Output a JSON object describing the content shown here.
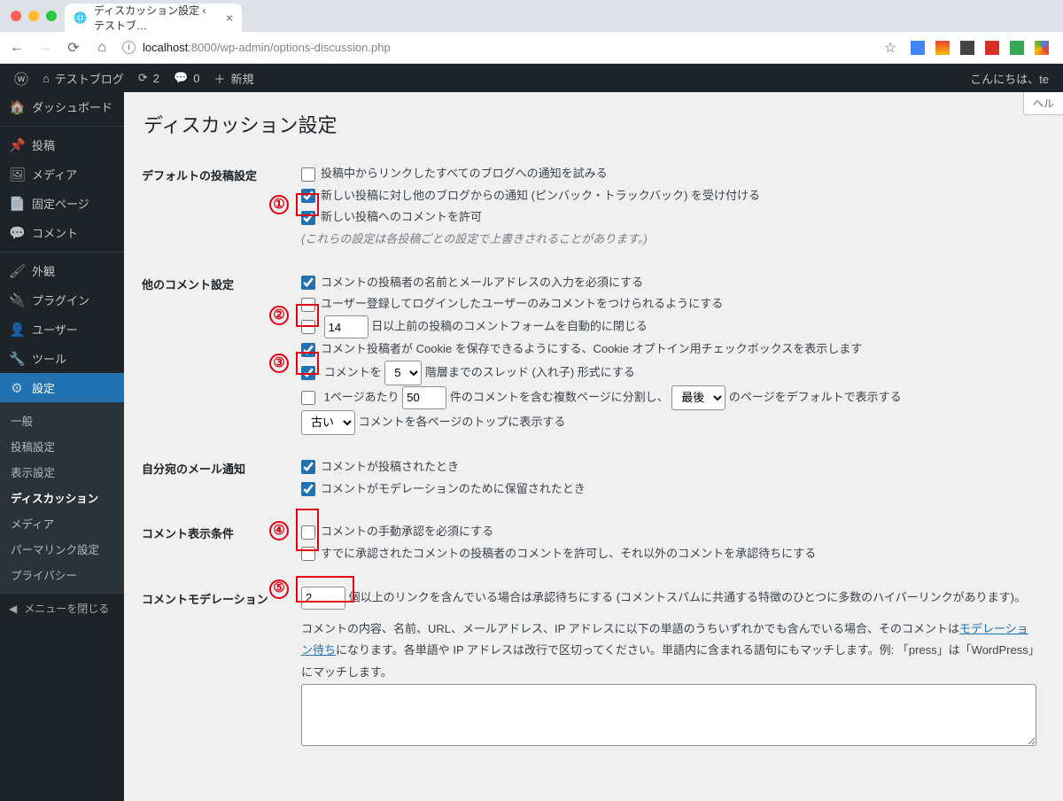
{
  "browser": {
    "tab_title": "ディスカッション設定 ‹ テストブ…",
    "url_host": "localhost",
    "url_port": ":8000",
    "url_path": "/wp-admin/options-discussion.php"
  },
  "adminbar": {
    "site_name": "テストブログ",
    "updates": "2",
    "comments": "0",
    "new": "新規",
    "greeting": "こんにちは、te"
  },
  "sidebar": {
    "dashboard": "ダッシュボード",
    "posts": "投稿",
    "media": "メディア",
    "pages": "固定ページ",
    "comments": "コメント",
    "appearance": "外観",
    "plugins": "プラグイン",
    "users": "ユーザー",
    "tools": "ツール",
    "settings": "設定",
    "submenu": {
      "general": "一般",
      "writing": "投稿設定",
      "reading": "表示設定",
      "discussion": "ディスカッション",
      "media": "メディア",
      "permalink": "パーマリンク設定",
      "privacy": "プライバシー"
    },
    "collapse": "メニューを閉じる"
  },
  "page": {
    "help_tab": "ヘル",
    "title": "ディスカッション設定",
    "sections": {
      "default_post": {
        "heading": "デフォルトの投稿設定",
        "opt_pingback": "投稿中からリンクしたすべてのブログへの通知を試みる",
        "opt_trackback": "新しい投稿に対し他のブログからの通知 (ピンバック・トラックバック) を受け付ける",
        "opt_allow_comments": "新しい投稿へのコメントを許可",
        "note": "(これらの設定は各投稿ごとの設定で上書きされることがあります。)"
      },
      "other_comment": {
        "heading": "他のコメント設定",
        "opt_require_name": "コメントの投稿者の名前とメールアドレスの入力を必須にする",
        "opt_require_login": "ユーザー登録してログインしたユーザーのみコメントをつけられるようにする",
        "opt_auto_close_days": "14",
        "opt_auto_close_text": "日以上前の投稿のコメントフォームを自動的に閉じる",
        "opt_cookie": "コメント投稿者が Cookie を保存できるようにする、Cookie オプトイン用チェックボックスを表示します",
        "thread_prefix": "コメントを",
        "thread_depth": "5",
        "thread_suffix": "階層までのスレッド (入れ子) 形式にする",
        "page_prefix": "1ページあたり",
        "page_count": "50",
        "page_mid": "件のコメントを含む複数ページに分割し、",
        "page_default": "最後",
        "page_suffix": "のページをデフォルトで表示する",
        "order": "古い",
        "order_suffix": "コメントを各ページのトップに表示する"
      },
      "email_me": {
        "heading": "自分宛のメール通知",
        "opt_posted": "コメントが投稿されたとき",
        "opt_moderation": "コメントがモデレーションのために保留されたとき"
      },
      "before_appear": {
        "heading": "コメント表示条件",
        "opt_manual": "コメントの手動承認を必須にする",
        "opt_previously": "すでに承認されたコメントの投稿者のコメントを許可し、それ以外のコメントを承認待ちにする"
      },
      "moderation": {
        "heading": "コメントモデレーション",
        "links_count": "2",
        "links_text": "個以上のリンクを含んでいる場合は承認待ちにする (コメントスパムに共通する特徴のひとつに多数のハイパーリンクがあります)。",
        "desc_prefix": "コメントの内容、名前、URL、メールアドレス、IP アドレスに以下の単語のうちいずれかでも含んでいる場合、そのコメントは",
        "desc_link": "モデレーション待ち",
        "desc_suffix": "になります。各単語や IP アドレスは改行で区切ってください。単語内に含まれる語句にもマッチします。例: 「press」は「WordPress」にマッチします。"
      }
    }
  },
  "annotations": {
    "a1": "①",
    "a2": "②",
    "a3": "③",
    "a4": "④",
    "a5": "⑤"
  }
}
